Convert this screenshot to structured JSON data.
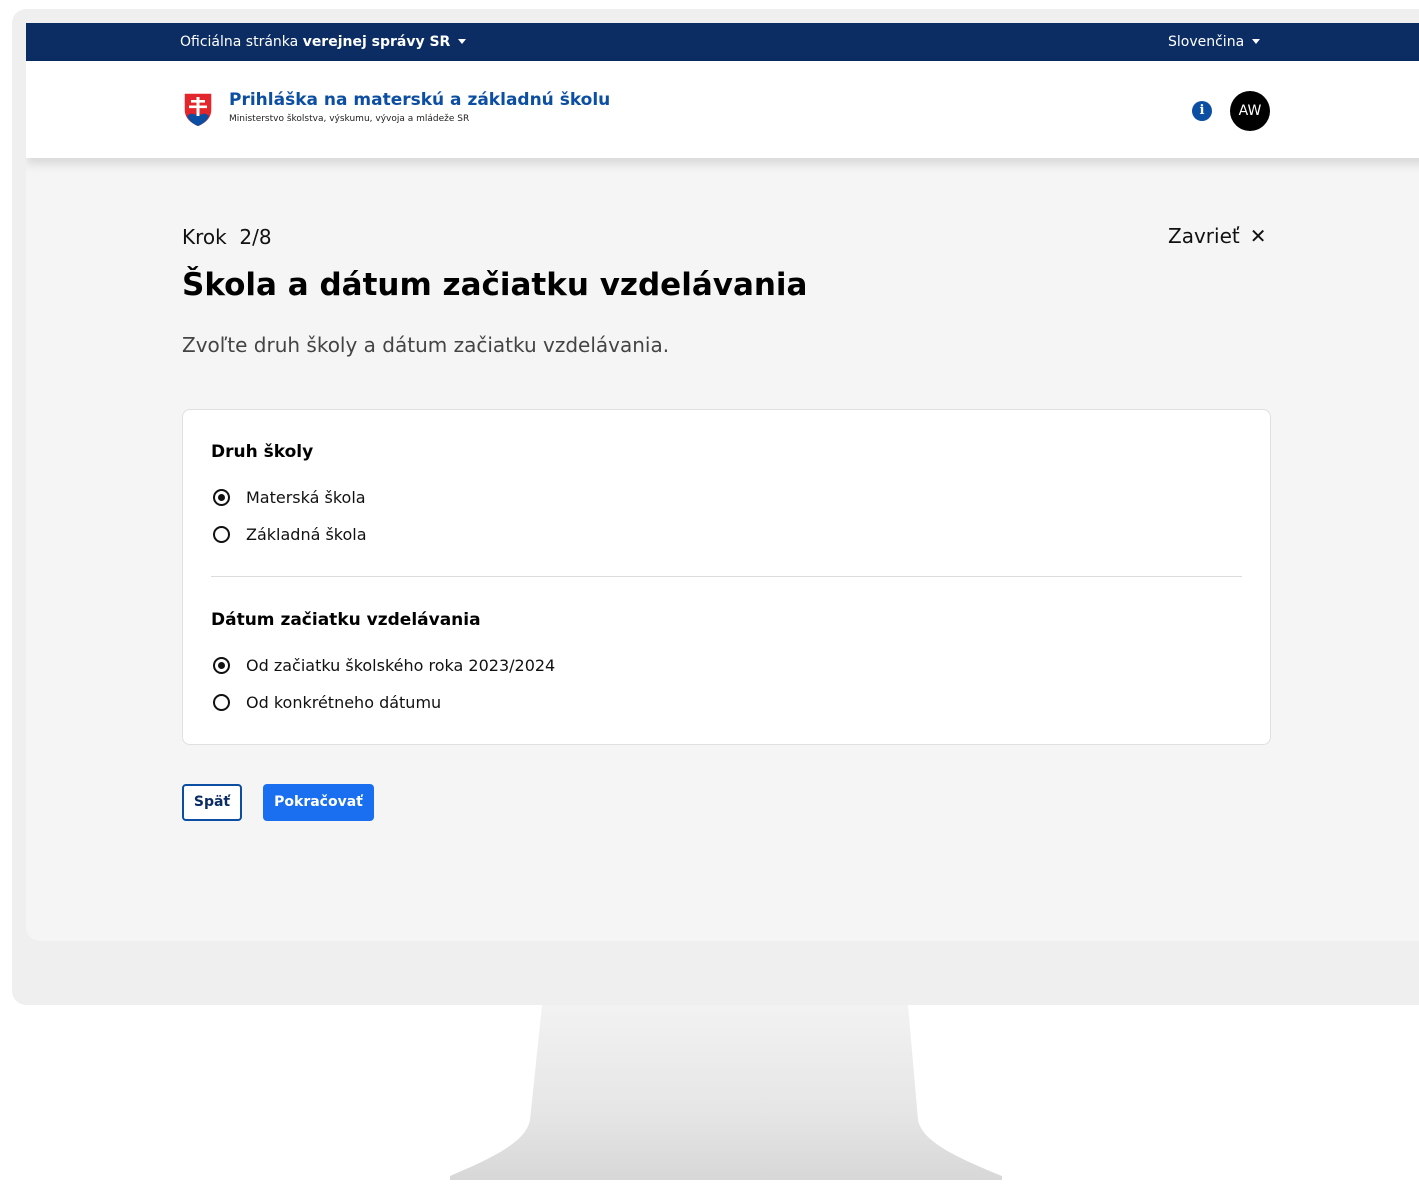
{
  "topbar": {
    "official_prefix": "Oficiálna stránka ",
    "official_bold": "verejnej správy SR",
    "language": "Slovenčina"
  },
  "header": {
    "title": "Prihláška na materskú a základnú školu",
    "subtitle": "Ministerstvo školstva, výskumu, vývoja a mládeže SR",
    "info_icon": "info-icon",
    "avatar_initials": "AW"
  },
  "page": {
    "step": "Krok  2/8",
    "close_label": "Zavrieť",
    "title": "Škola a dátum začiatku vzdelávania",
    "description": "Zvoľte druh školy a dátum začiatku vzdelávania."
  },
  "form": {
    "school_type": {
      "label": "Druh školy",
      "options": [
        "Materská škola",
        "Základná škola"
      ],
      "selected": "Materská škola"
    },
    "start_date": {
      "label": "Dátum začiatku vzdelávania",
      "options": [
        "Od začiatku školského roka 2023/2024",
        "Od konkrétneho dátumu"
      ],
      "selected": "Od začiatku školského roka 2023/2024"
    }
  },
  "actions": {
    "back_label": "Späť",
    "continue_label": "Pokračovať"
  },
  "colors": {
    "topbar": "#0b2d63",
    "brand_blue": "#0b4ea2",
    "primary_button": "#1a6ff0"
  }
}
